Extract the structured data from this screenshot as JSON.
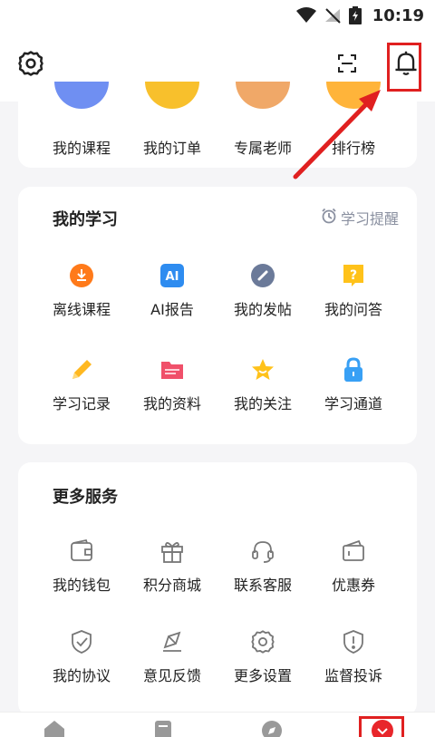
{
  "status_bar": {
    "time": "10:19"
  },
  "header": {
    "settings_icon": "gear-icon",
    "scan_icon": "scan-icon",
    "bell_icon": "bell-icon"
  },
  "top_card": {
    "items": [
      {
        "label": "我的课程",
        "color": "#6f8ff2"
      },
      {
        "label": "我的订单",
        "color": "#f8c02c"
      },
      {
        "label": "专属老师",
        "color": "#f0a868"
      },
      {
        "label": "排行榜",
        "color": "#ffb43a"
      }
    ]
  },
  "study": {
    "title": "我的学习",
    "reminder": "学习提醒",
    "items": [
      {
        "label": "离线课程",
        "icon": "download-icon"
      },
      {
        "label": "AI报告",
        "icon": "ai-icon"
      },
      {
        "label": "我的发帖",
        "icon": "post-icon"
      },
      {
        "label": "我的问答",
        "icon": "question-icon"
      },
      {
        "label": "学习记录",
        "icon": "pencil-icon"
      },
      {
        "label": "我的资料",
        "icon": "folder-icon"
      },
      {
        "label": "我的关注",
        "icon": "star-icon"
      },
      {
        "label": "学习通道",
        "icon": "lock-icon"
      }
    ]
  },
  "more": {
    "title": "更多服务",
    "items": [
      {
        "label": "我的钱包",
        "icon": "wallet-icon"
      },
      {
        "label": "积分商城",
        "icon": "gift-icon"
      },
      {
        "label": "联系客服",
        "icon": "headset-icon"
      },
      {
        "label": "优惠券",
        "icon": "coupon-icon"
      },
      {
        "label": "我的协议",
        "icon": "shield-check-icon"
      },
      {
        "label": "意见反馈",
        "icon": "feedback-icon"
      },
      {
        "label": "更多设置",
        "icon": "settings-icon"
      },
      {
        "label": "监督投诉",
        "icon": "complaint-icon"
      }
    ]
  },
  "tabbar": {
    "tabs": [
      "home-icon",
      "document-icon",
      "compass-icon",
      "profile-icon"
    ],
    "active_color": "#e8262b"
  }
}
